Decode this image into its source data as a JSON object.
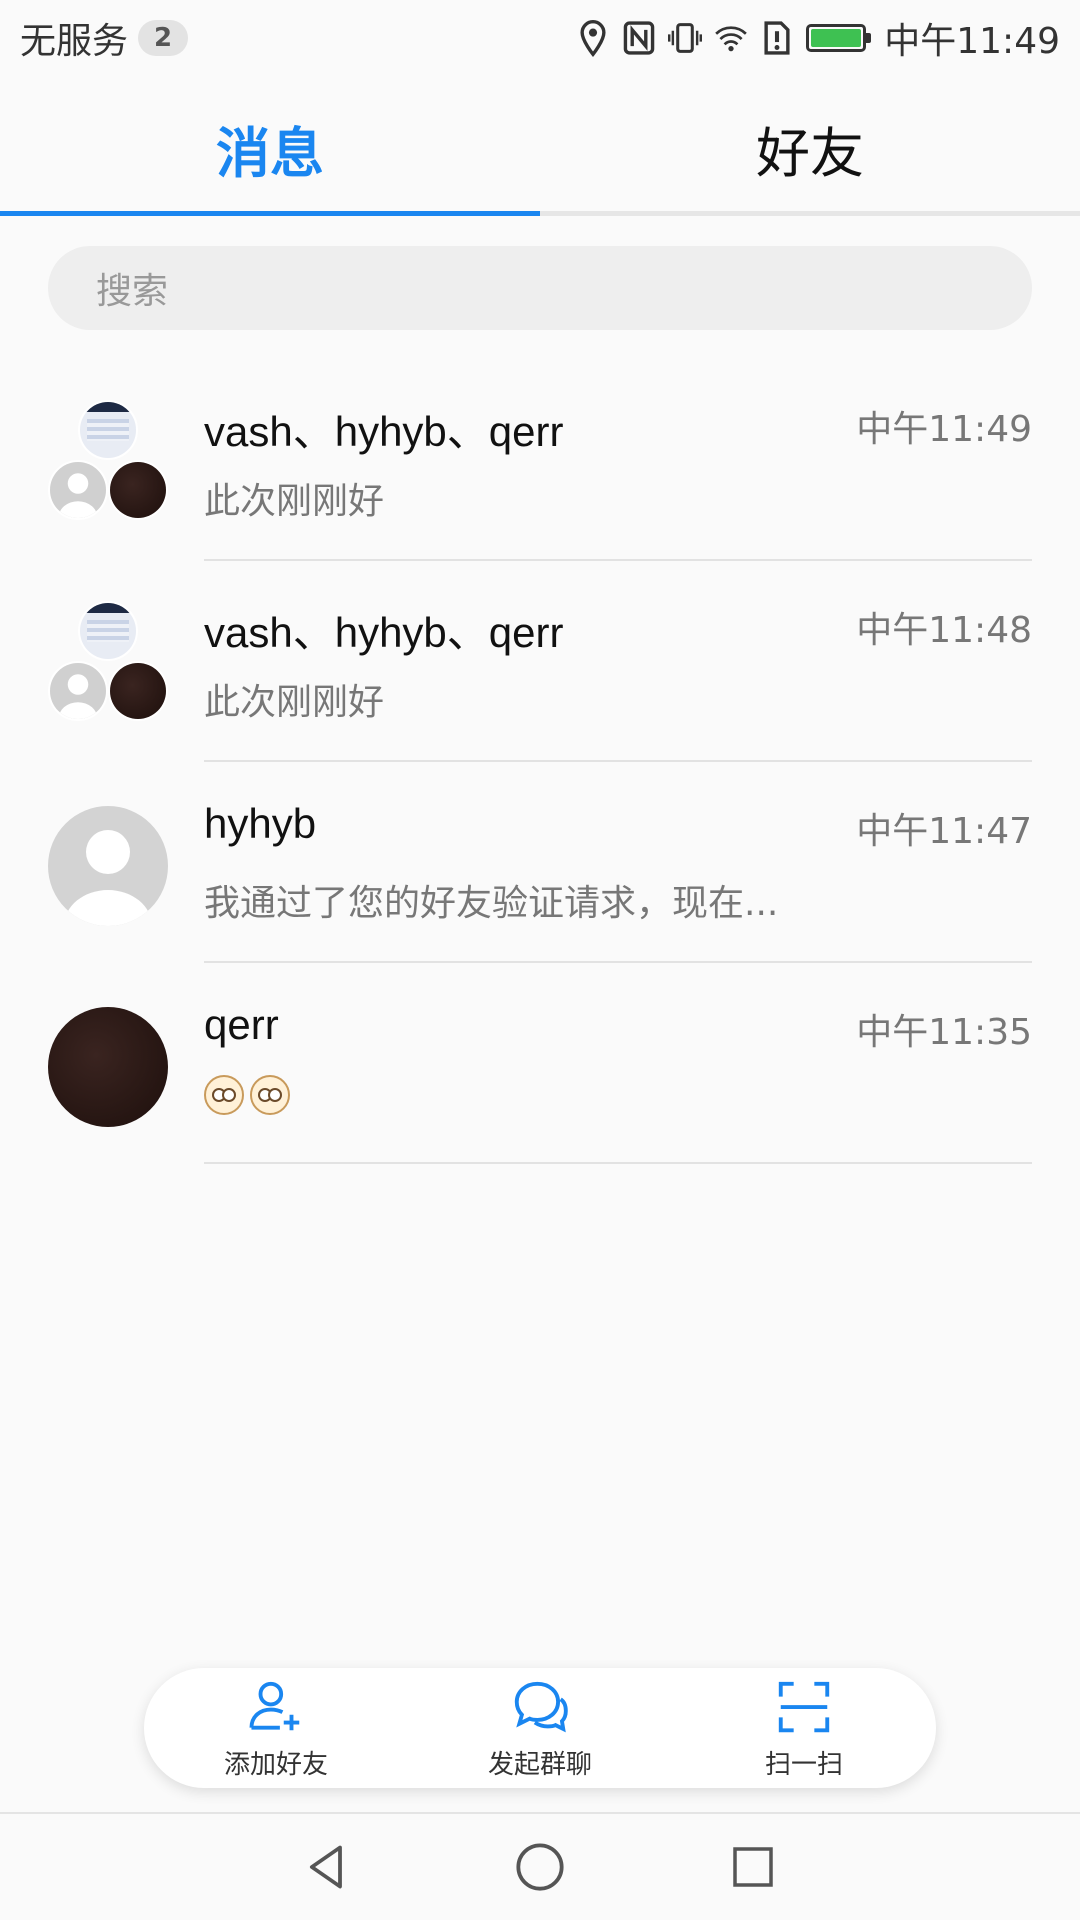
{
  "status_bar": {
    "carrier": "无服务",
    "sim_badge": "2",
    "time": "中午11:49",
    "battery_level": 0.85,
    "accent_color": "#3ec152"
  },
  "tabs": [
    {
      "label": "消息",
      "active": true
    },
    {
      "label": "好友",
      "active": false
    }
  ],
  "search": {
    "placeholder": "搜索"
  },
  "conversations": [
    {
      "name": "vash、hyhyb、qerr",
      "message": "此次刚刚好",
      "time": "中午11:49",
      "avatar": "group"
    },
    {
      "name": "vash、hyhyb、qerr",
      "message": "此次刚刚好",
      "time": "中午11:48",
      "avatar": "group"
    },
    {
      "name": "hyhyb",
      "message": "我通过了您的好友验证请求，现在...",
      "time": "中午11:47",
      "avatar": "default-person"
    },
    {
      "name": "qerr",
      "message": "",
      "time": "中午11:35",
      "avatar": "dark-photo",
      "emoji_count": 2
    }
  ],
  "actions": [
    {
      "label": "添加好友",
      "icon": "add-friend-icon"
    },
    {
      "label": "发起群聊",
      "icon": "group-chat-icon"
    },
    {
      "label": "扫一扫",
      "icon": "scan-icon"
    }
  ],
  "nav": {
    "back_icon": "back-triangle-icon",
    "home_icon": "home-circle-icon",
    "recents_icon": "recents-square-icon"
  },
  "colors": {
    "accent": "#1a86f0",
    "secondary_text": "#777777"
  }
}
